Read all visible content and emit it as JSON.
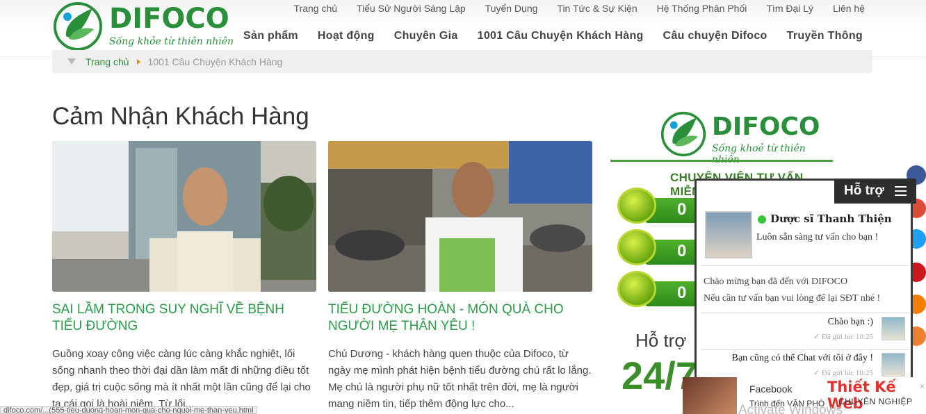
{
  "header": {
    "logo_text": "DIFOCO",
    "logo_slogan": "Sống khỏe từ thiên nhiên",
    "top_links": [
      "Trang chủ",
      "Tiểu Sử Người Sáng Lập",
      "Tuyển Dụng",
      "Tin Tức & Sự Kiện",
      "Hệ Thống Phân Phối",
      "Tìm Đại Lý",
      "Liên hệ"
    ],
    "main_nav": [
      "Sản phẩm",
      "Hoạt động",
      "Chuyên Gia",
      "1001 Câu Chuyện Khách Hàng",
      "Câu chuyện Difoco",
      "Truyền Thông"
    ]
  },
  "breadcrumb": {
    "home": "Trang chủ",
    "current": "1001 Câu Chuyện Khách Hàng"
  },
  "main": {
    "title": "Cảm Nhận Khách Hàng",
    "cards": [
      {
        "title": "SAI LẦM TRONG SUY NGHĨ VỀ BỆNH TIỂU ĐƯỜNG",
        "excerpt": "Guồng xoay công việc càng lúc càng khắc nghiệt, lối sống nhanh theo thời đại dần làm mất đi những điều tốt đẹp, giá trị cuộc sống mà ít nhất một lần cũng để lại cho ta cái gọi là hoài niệm. Từ lối..."
      },
      {
        "title": "TIỂU ĐƯỜNG HOÀN - MÓN QUÀ CHO NGƯỜI MẸ THÂN YÊU !",
        "excerpt": "Chú Dương - khách hàng quen thuộc của Difoco, từ ngày mẹ mình phát hiện bệnh tiểu đường chú rất lo lắng. Mẹ chú là người phụ nữ tốt nhất trên đời, mẹ là người mang niềm tin, tiếp thêm động lực cho..."
      }
    ]
  },
  "banner": {
    "logo_text": "DIFOCO",
    "slogan": "Sống khoẻ từ thiên nhiên",
    "heading": "CHUYÊN VIÊN TƯ VẤN MIỄN PHÍ",
    "phone_digits": [
      "0",
      "0",
      "0"
    ],
    "support": "Hỗ trợ",
    "hours": "24/7"
  },
  "chat": {
    "tab_label": "Hỗ trợ",
    "agent_name": "Dược sĩ Thanh Thiện",
    "agent_status": "Luôn sẵn sàng tư vấn cho bạn !",
    "welcome_line1": "Chào mừng bạn đã đến với DIFOCO",
    "welcome_line2": "Nếu cần tư vấn bạn vui lòng để lại SĐT nhé !",
    "msg1": "Chào bạn :)",
    "msg1_time": "✓ Đã gửi lúc 10:25",
    "msg2": "Bạn cũng có thể Chat với tôi ở đây !",
    "msg2_time": "✓ Đã gửi lúc 10:25"
  },
  "footer_widget": {
    "fb_label": "Facebook",
    "fb_sub": "Trình đến VĂN PHÒ",
    "brand_main": "Thiết Kế Web",
    "brand_sub": "CHUYÊN NGHIỆP",
    "close": "×",
    "watermark": "Activate Windows"
  },
  "status_url": "difoco.com/...(555-tieu-duong-hoan-mon-qua-cho-nguoi-me-than-yeu.html",
  "colors": {
    "brand_green": "#2a8f3a",
    "title_green": "#2a9b48",
    "breadcrumb_arrow": "#f08a00"
  }
}
